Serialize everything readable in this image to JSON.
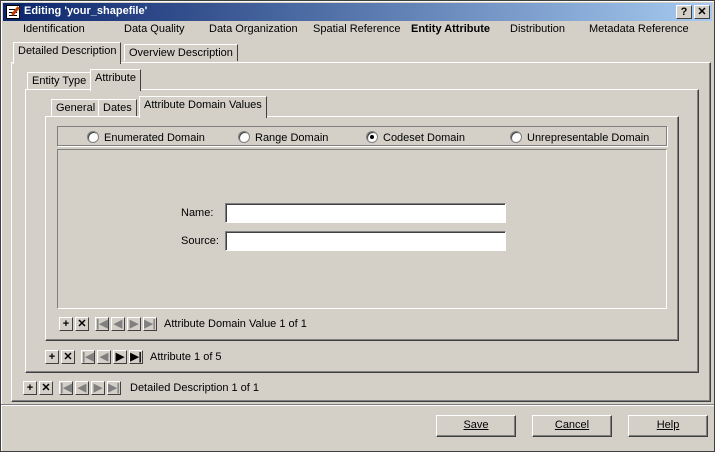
{
  "window": {
    "title": "Editing 'your_shapefile'"
  },
  "topmenu": {
    "items": [
      "Identification",
      "Data Quality",
      "Data Organization",
      "Spatial Reference",
      "Entity Attribute",
      "Distribution",
      "Metadata Reference"
    ],
    "active": "Entity Attribute"
  },
  "tabs_level1": [
    "Detailed Description",
    "Overview Description"
  ],
  "tabs_level2": [
    "Entity Type",
    "Attribute"
  ],
  "tabs_level3": [
    "General",
    "Dates",
    "Attribute Domain Values"
  ],
  "domain_options": {
    "enumerated": "Enumerated Domain",
    "range": "Range Domain",
    "codeset": "Codeset Domain",
    "unrepresentable": "Unrepresentable Domain",
    "selected": "codeset"
  },
  "form": {
    "name_label": "Name:",
    "name_value": "",
    "source_label": "Source:",
    "source_value": ""
  },
  "nav": {
    "domain_value": "Attribute Domain Value 1 of 1",
    "attribute": "Attribute 1 of 5",
    "detailed": "Detailed Description 1 of 1"
  },
  "nav_glyphs": {
    "add": "+",
    "delete": "✕",
    "first": "|◀",
    "prev": "◀",
    "next": "▶",
    "last": "▶|"
  },
  "buttons": {
    "save": "Save",
    "cancel": "Cancel",
    "help": "Help"
  },
  "title_buttons": {
    "help": "?",
    "close": "✕"
  }
}
